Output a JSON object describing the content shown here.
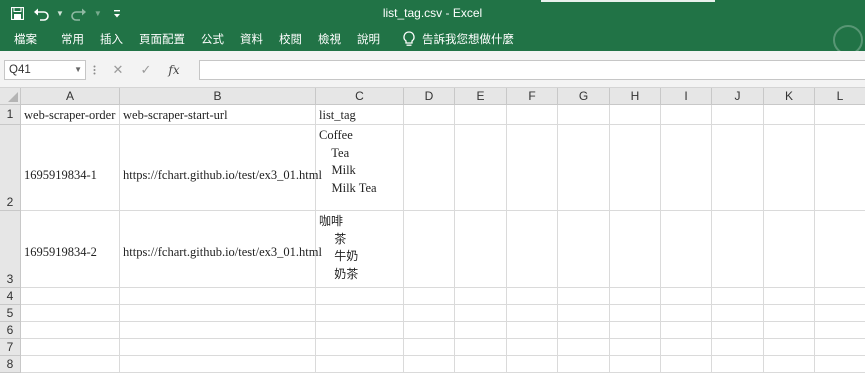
{
  "window": {
    "title": "list_tag.csv  -  Excel"
  },
  "qat": {
    "save_icon": "save-icon",
    "undo_icon": "undo-icon",
    "redo_icon": "redo-icon",
    "customize_icon": "customize-qat-icon"
  },
  "ribbon": {
    "tabs": [
      "檔案",
      "常用",
      "插入",
      "頁面配置",
      "公式",
      "資料",
      "校閱",
      "檢視",
      "說明"
    ],
    "tell_me": "告訴我您想做什麼"
  },
  "formula_bar": {
    "name_box": "Q41",
    "cancel_symbol": "✕",
    "enter_symbol": "✓",
    "fx_symbol": "fx",
    "formula": ""
  },
  "sheet": {
    "columns": [
      "A",
      "B",
      "C",
      "D",
      "E",
      "F",
      "G",
      "H",
      "I",
      "J",
      "K",
      "L"
    ],
    "rows": [
      "1",
      "2",
      "3",
      "4",
      "5",
      "6",
      "7",
      "8"
    ],
    "cells": {
      "A1": "web-scraper-order",
      "B1": "web-scraper-start-url",
      "C1": "list_tag",
      "A2": "1695919834-1",
      "B2": "https://fchart.github.io/test/ex3_01.html",
      "C2": "Coffee\n    Tea\n    Milk\n    Milk Tea",
      "A3": "1695919834-2",
      "B3": "https://fchart.github.io/test/ex3_01.html",
      "C3": "咖啡\n    茶\n    牛奶\n    奶茶"
    }
  },
  "colors": {
    "excel_green": "#217346",
    "header_gray": "#e6e6e6",
    "gridline": "#dadada"
  }
}
